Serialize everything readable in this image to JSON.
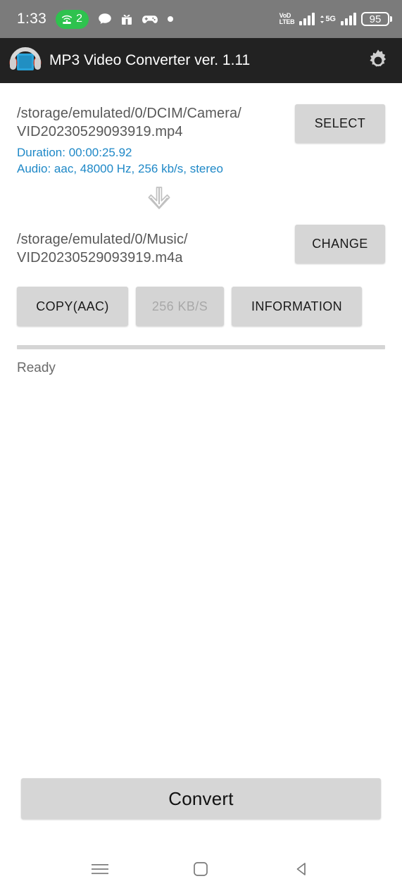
{
  "status_bar": {
    "time": "1:33",
    "hotspot_badge": "2",
    "icons": [
      "wifi-hotspot-icon",
      "chat-bubble-icon",
      "gift-box-icon",
      "game-controller-icon",
      "dot-icon"
    ],
    "volte_line1": "VoD",
    "volte_line2": "LTEB",
    "network_label": "5G",
    "battery_percent": "95",
    "background_color": "#7b7b7b"
  },
  "app_bar": {
    "title": "MP3 Video Converter ver. 1.11",
    "icon": "headphones-app-icon",
    "settings_icon": "gear-icon",
    "background_color": "#222222"
  },
  "input_file": {
    "path_line1": "/storage/emulated/0/DCIM/Camera/",
    "path_line2": "VID20230529093919.mp4",
    "duration": "Duration: 00:00:25.92",
    "audio": "Audio: aac, 48000 Hz, 256 kb/s,  stereo",
    "select_label": "SELECT",
    "meta_color": "#1e88c7"
  },
  "output_file": {
    "path_line1": "/storage/emulated/0/Music/",
    "path_line2": "VID20230529093919.m4a",
    "change_label": "CHANGE"
  },
  "options": {
    "codec_label": "COPY(AAC)",
    "bitrate_label": "256 KB/S",
    "bitrate_disabled": true,
    "information_label": "INFORMATION"
  },
  "progress": {
    "percent": 0,
    "status_text": "Ready"
  },
  "convert": {
    "label": "Convert"
  },
  "nav_bar": {
    "recents_icon": "menu-lines-icon",
    "home_icon": "home-square-icon",
    "back_icon": "back-triangle-icon"
  }
}
